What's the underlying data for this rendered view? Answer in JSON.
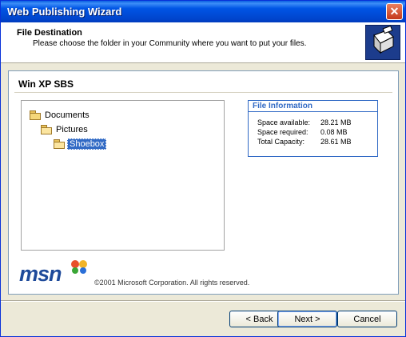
{
  "window": {
    "title": "Web Publishing Wizard"
  },
  "header": {
    "title": "File Destination",
    "subtitle": "Please choose the folder in your Community where you want to put your files."
  },
  "content": {
    "title": "Win XP SBS",
    "tree": [
      {
        "label": "Documents",
        "icon": "folder-icon",
        "selected": false
      },
      {
        "label": "Pictures",
        "icon": "folder-open-icon",
        "selected": false
      },
      {
        "label": "Shoebox",
        "icon": "folder-open-icon",
        "selected": true
      }
    ],
    "file_info": {
      "title": "File Information",
      "rows": [
        {
          "label": "Space available:",
          "value": "28.21 MB"
        },
        {
          "label": "Space required:",
          "value": "0.08 MB"
        },
        {
          "label": "Total Capacity:",
          "value": "28.61 MB"
        }
      ]
    },
    "logo": "msn",
    "copyright": "©2001 Microsoft Corporation. All rights reserved."
  },
  "buttons": {
    "back": "< Back",
    "next": "Next >",
    "cancel": "Cancel"
  },
  "colors": {
    "accent": "#316ac5",
    "title_bar": "#0055e5",
    "msn_blue": "#1e4a9a"
  }
}
